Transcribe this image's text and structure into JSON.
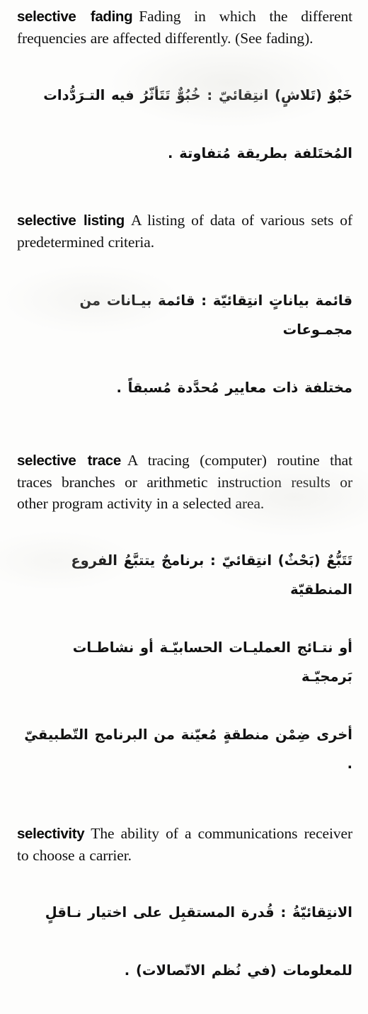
{
  "page": {
    "type": "dictionary-page",
    "language_pair": "English-Arabic",
    "ink_color": "#111111",
    "paper_color": "#fdfdfc"
  },
  "entries": [
    {
      "headword": "selective fading",
      "definition_en": "Fading in which the different frequencies are affected differently. (See fading).",
      "arabic_lines": [
        "خَبْوٌ (تَلاشٍ) انتِقائيّ : خُبُوٌّ تَتَأثّرُ فيه التـرَدُّدات",
        "المُختَلفة بطريقة مُتفاوتة ."
      ]
    },
    {
      "headword": "selective listing",
      "definition_en": "A listing of data of various sets of predetermined criteria.",
      "arabic_lines": [
        "قائمة بياناتٍ انتِقائيّة : قائمة بيـانات من مجمـوعات",
        "مختلفة ذات معايير مُحدَّدة مُسبقاً ."
      ]
    },
    {
      "headword": "selective trace",
      "definition_en": "A tracing (computer) routine that traces branches or arithmetic instruction results or other program activity in a selected area.",
      "arabic_lines": [
        "تَتَبُّعٌ (بَحْثٌ) انتِقائيّ : برنامجٌ يتتبَّعُ الفروع المنطقيّة",
        "أو نتـائج العمليـات الحسابيّـة أو نشاطـات بَرمجيّـة",
        "أخرى ضِمْن منطقةٍ مُعيّنة من البرنامج التّطبيقيّ ."
      ]
    },
    {
      "headword": "selectivity",
      "definition_en": "The ability of a communications receiver to choose a carrier.",
      "arabic_lines": [
        "الانتِقائيّةُ : قُدرة المستقبِل على اختيار نـاقلٍ",
        "للمعلومات (في نُظم الاتّصالات) ."
      ]
    }
  ]
}
